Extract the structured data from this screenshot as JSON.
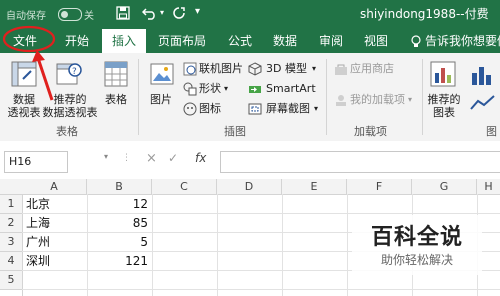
{
  "titlebar": {
    "autosave_label": "自动保存",
    "toggle_state": "关",
    "user_label": "shiyindong1988--付费"
  },
  "tabs": [
    {
      "label": "文件"
    },
    {
      "label": "开始"
    },
    {
      "label": "插入"
    },
    {
      "label": "页面布局"
    },
    {
      "label": "公式"
    },
    {
      "label": "数据"
    },
    {
      "label": "审阅"
    },
    {
      "label": "视图"
    },
    {
      "label": "告诉我你想要做什"
    }
  ],
  "ribbon": {
    "pivot_table": "数据\n透视表",
    "recommended_pivot": "推荐的\n数据透视表",
    "table": "表格",
    "group_tables": "表格",
    "picture": "图片",
    "online_picture": "联机图片",
    "shapes": "形状",
    "icons": "图标",
    "model_3d": "3D 模型",
    "smartart": "SmartArt",
    "screenshot": "屏幕截图",
    "group_illustrations": "插图",
    "store": "应用商店",
    "my_addins": "我的加载项",
    "group_addins": "加载项",
    "recommended_charts": "推荐的\n图表",
    "group_charts": "图表"
  },
  "formula_bar": {
    "name_box": "H16",
    "cancel": "×",
    "enter": "✓",
    "fx": "fx",
    "formula": ""
  },
  "grid": {
    "columns": [
      "A",
      "B",
      "C",
      "D",
      "E",
      "F",
      "G",
      "H"
    ],
    "rows": [
      {
        "num": "1",
        "a": "北京",
        "b": "12"
      },
      {
        "num": "2",
        "a": "上海",
        "b": "85"
      },
      {
        "num": "3",
        "a": "广州",
        "b": "5"
      },
      {
        "num": "4",
        "a": "深圳",
        "b": "121"
      },
      {
        "num": "5",
        "a": "",
        "b": ""
      }
    ]
  },
  "watermark": {
    "title": "百科全说",
    "subtitle": "助你轻松解决"
  },
  "colors": {
    "excel_green": "#217346",
    "annotation_red": "#e0201e"
  }
}
